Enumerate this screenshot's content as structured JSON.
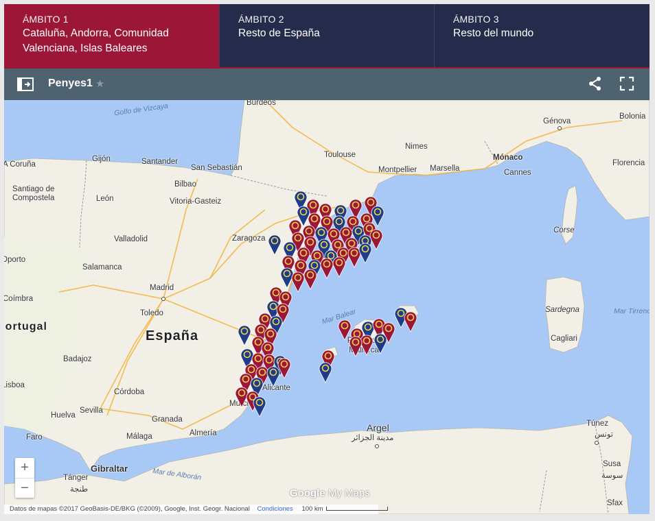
{
  "tabs": [
    {
      "kicker": "ÁMBITO 1",
      "title": "Cataluña, Andorra, Comunidad Valenciana, Islas Baleares",
      "active": true
    },
    {
      "kicker": "ÁMBITO 2",
      "title": "Resto de España",
      "active": false
    },
    {
      "kicker": "ÁMBITO 3",
      "title": "Resto del mundo",
      "active": false
    }
  ],
  "toolbar": {
    "map_title": "Penyes1",
    "icons": [
      "legend-toggle-icon",
      "star-icon",
      "share-icon",
      "fullscreen-icon"
    ]
  },
  "colors": {
    "active_tab": "#9c1638",
    "inactive_tab": "#252b4a",
    "toolbar": "#4e6270",
    "sea": "#a8c8f6",
    "land": "#f2efe6",
    "marker_fill": "#1f3c88",
    "marker_ring": "#f4d84a",
    "marker_red": "#9c1638"
  },
  "map": {
    "country_labels": [
      "España",
      "Mónaco",
      "Portugal"
    ],
    "sea_labels": [
      "Golfo de Vizcaya",
      "Mar Balear",
      "Mar de Alborán",
      "Mar Tirreno"
    ],
    "island_labels": [
      "Corse",
      "Sardegna"
    ],
    "cities": [
      "Burdeos",
      "Toulouse",
      "Nimes",
      "Montpellier",
      "Marsella",
      "Cannes",
      "Génova",
      "Bolonia",
      "Florencia",
      "A Coruña",
      "Gijón",
      "Santander",
      "San Sebastián",
      "Santiago de Compostela",
      "Bilbao",
      "Vitoria-Gasteiz",
      "León",
      "Zaragoza",
      "Valladolid",
      "Salamanca",
      "Madrid",
      "Toledo",
      "Coímbra",
      "Badajoz",
      "Córdoba",
      "Sevilla",
      "Huelva",
      "Faro",
      "Granada",
      "Almería",
      "Málaga",
      "Murcia",
      "Alicante",
      "Palma de Mallorca",
      "Cagliari",
      "Argel",
      "مدينة الجزائر",
      "Túnez",
      "تونس",
      "Susa",
      "سوسة",
      "Sfax",
      "Gibraltar",
      "Tánger",
      "طنجة",
      "Oporto",
      "Lisboa"
    ],
    "zoom_in": "+",
    "zoom_out": "−",
    "logo_google": "Google",
    "logo_mymaps": "My Maps",
    "attribution": "Datos de mapas ©2017 GeoBasis-DE/BKG (©2009), Google, Inst. Geogr. Nacional",
    "terms": "Condiciones",
    "scale": "100 km"
  }
}
